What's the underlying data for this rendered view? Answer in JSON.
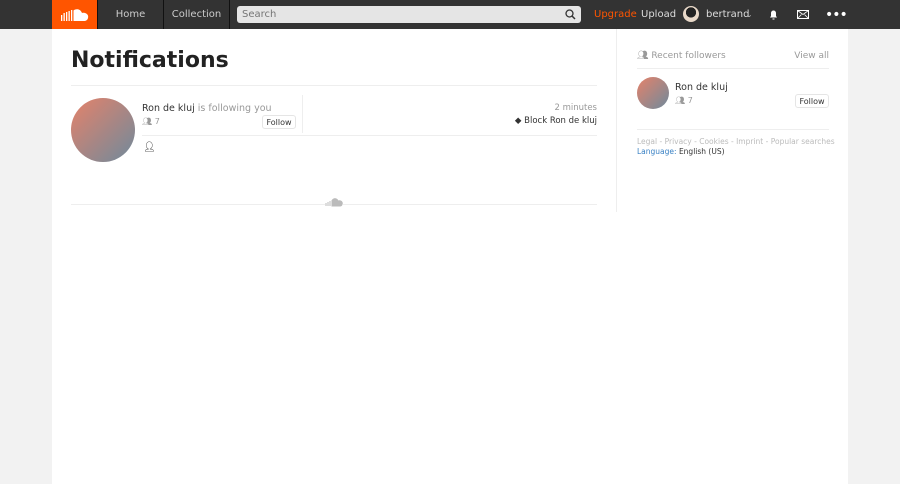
{
  "header": {
    "home": "Home",
    "collection": "Collection",
    "search_placeholder": "Search",
    "upgrade": "Upgrade",
    "upload": "Upload",
    "username": "bertrand"
  },
  "main": {
    "title": "Notifications",
    "notification": {
      "user": "Ron de kluj",
      "action": "is following you",
      "followers": "7",
      "follow": "Follow",
      "time": "2 minutes",
      "block": "Block Ron de kluj"
    }
  },
  "sidebar": {
    "heading": "Recent followers",
    "view_all": "View all",
    "follower": {
      "name": "Ron de kluj",
      "followers": "7",
      "follow": "Follow"
    },
    "footer_links": [
      "Legal",
      "Privacy",
      "Cookies",
      "Imprint",
      "Popular searches"
    ],
    "language_label": "Language:",
    "language": "English (US)"
  },
  "colors": {
    "brand": "#ff5500",
    "header": "#333333",
    "link": "#3880c4"
  }
}
